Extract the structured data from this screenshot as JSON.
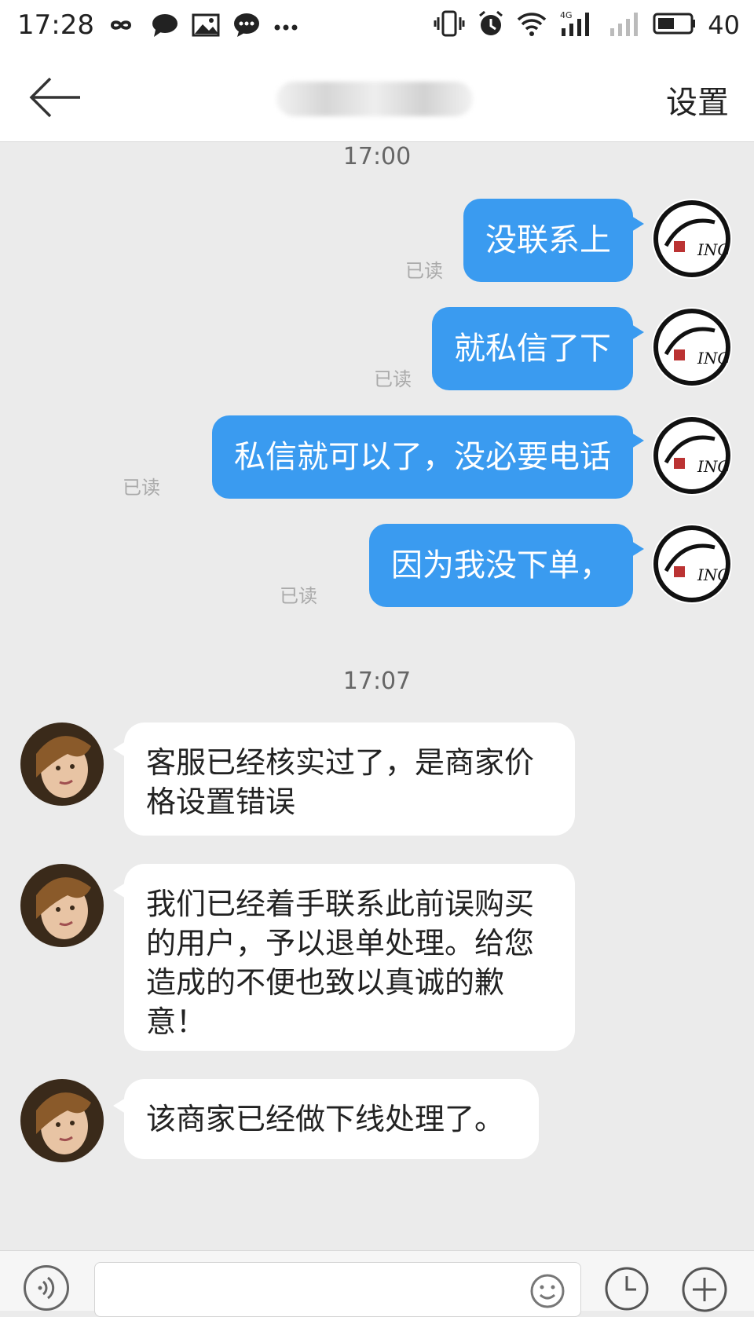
{
  "status_bar": {
    "time": "17:28",
    "battery": "40",
    "left_icons": [
      "infinity-icon",
      "chat-bubble-icon",
      "image-icon",
      "message-icon",
      "more-icon"
    ],
    "right_icons": [
      "vibrate-icon",
      "alarm-icon",
      "wifi-icon",
      "signal-4g-icon",
      "signal-icon",
      "battery-icon"
    ]
  },
  "header": {
    "title": "",
    "settings_label": "设置"
  },
  "chat": {
    "timestamps": [
      "17:00",
      "17:07"
    ],
    "sent": [
      {
        "text": "没联系上",
        "status": "已读"
      },
      {
        "text": "就私信了下",
        "status": "已读"
      },
      {
        "text": "私信就可以了，没必要电话",
        "status": "已读"
      },
      {
        "text": "因为我没下单，",
        "status": "已读"
      }
    ],
    "received": [
      {
        "text": "客服已经核实过了，是商家价格设置错误"
      },
      {
        "text": "我们已经着手联系此前误购买的用户，予以退单处理。给您造成的不便也致以真诚的歉意！"
      },
      {
        "text": "该商家已经做下线处理了。"
      }
    ]
  },
  "input_bar": {
    "placeholder": ""
  },
  "colors": {
    "accent": "#3a9bf0",
    "background": "#ebebeb",
    "read_label": "#aaaaaa"
  }
}
